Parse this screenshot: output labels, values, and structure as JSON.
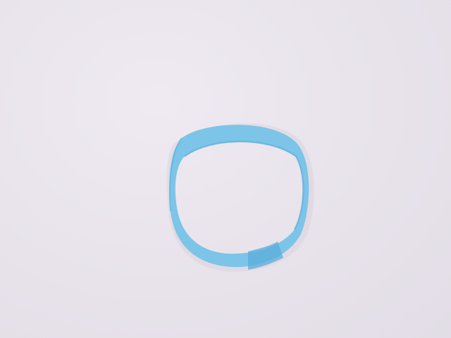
{
  "scene": {
    "subject": "blue-paper-loop",
    "background_color": "#e9e4ec",
    "band_color": "#7cc4e8",
    "band_edge_color": "#5fb0da",
    "band_overlap_color": "#5aaedb"
  }
}
